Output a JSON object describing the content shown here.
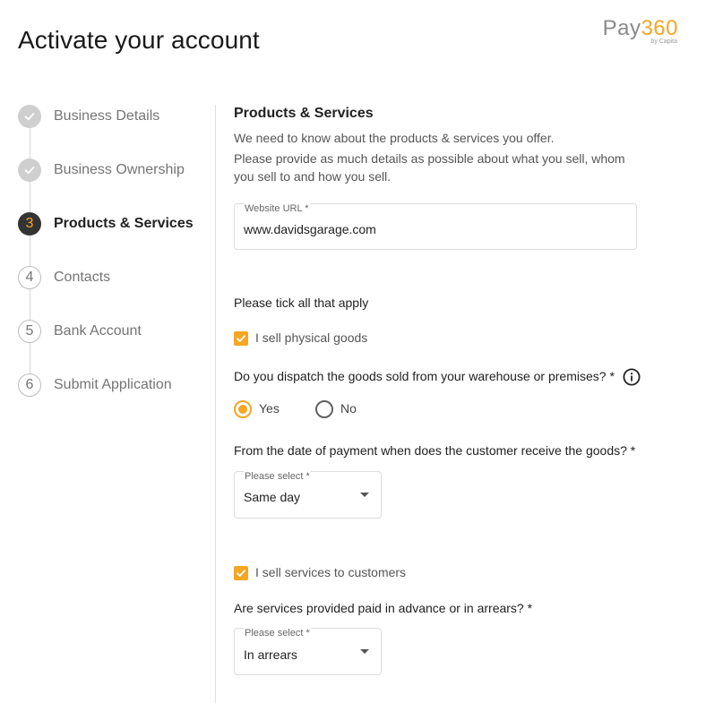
{
  "header": {
    "title": "Activate your account",
    "logo": {
      "text_main": "Pay",
      "text_num": "360",
      "subtext": "by Capita",
      "accent_color": "#f5a623"
    }
  },
  "stepper": {
    "steps": [
      {
        "marker": "",
        "label": "Business Details",
        "state": "done",
        "icon": "check-icon"
      },
      {
        "marker": "",
        "label": "Business Ownership",
        "state": "done",
        "icon": "check-icon"
      },
      {
        "marker": "3",
        "label": "Products & Services",
        "state": "active"
      },
      {
        "marker": "4",
        "label": "Contacts",
        "state": "todo"
      },
      {
        "marker": "5",
        "label": "Bank Account",
        "state": "todo"
      },
      {
        "marker": "6",
        "label": "Submit Application",
        "state": "todo"
      }
    ]
  },
  "form": {
    "section_title": "Products & Services",
    "intro_1": "We need to know about the products & services you offer.",
    "intro_2": "Please provide as much details as possible about what you sell, whom you sell to and how you sell.",
    "website": {
      "label": "Website URL *",
      "value": "www.davidsgarage.com"
    },
    "tick_prompt": "Please tick all that apply",
    "physical_goods": {
      "label": "I sell physical goods",
      "checked": true
    },
    "dispatch": {
      "question": "Do you dispatch the goods sold from your warehouse or premises? *",
      "options": [
        {
          "label": "Yes",
          "selected": true
        },
        {
          "label": "No",
          "selected": false
        }
      ]
    },
    "delivery": {
      "question": "From the date of payment when does the customer receive the goods? *",
      "select_label": "Please select *",
      "value": "Same day"
    },
    "services": {
      "label": "I sell services to customers",
      "checked": true
    },
    "payment_timing": {
      "question": "Are services provided paid in advance or in arrears? *",
      "select_label": "Please select *",
      "value": "In arrears"
    }
  },
  "colors": {
    "accent": "#f5a623",
    "active_step_bg": "#333333",
    "done_step_bg": "#cfcfcf"
  }
}
